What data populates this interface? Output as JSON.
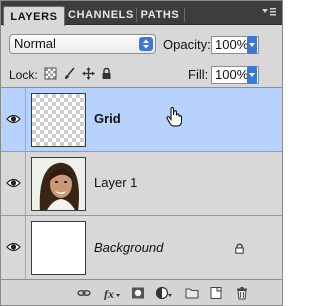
{
  "tabs": [
    {
      "label": "LAYERS",
      "active": true
    },
    {
      "label": "CHANNELS",
      "active": false
    },
    {
      "label": "PATHS",
      "active": false
    }
  ],
  "panel_menu_icon": "panel-menu-icon",
  "blend": {
    "value": "Normal"
  },
  "opacity": {
    "label": "Opacity:",
    "value": "100%"
  },
  "lock": {
    "label": "Lock:"
  },
  "fill": {
    "label": "Fill:",
    "value": "100%"
  },
  "layers": [
    {
      "name": "Grid",
      "selected": true,
      "visible": true,
      "thumbnail": "transparent-checkerboard"
    },
    {
      "name": "Layer 1",
      "selected": false,
      "visible": true,
      "thumbnail": "photo-woman-smiling"
    },
    {
      "name": "Background",
      "selected": false,
      "visible": true,
      "thumbnail": "white",
      "locked": true
    }
  ],
  "colors": {
    "selected_row": "#b7d3fd",
    "tab_bar": "#3d3d3d",
    "accent_blue": "#3d78d6"
  },
  "bottom_icons": [
    "link-layers-icon",
    "fx-icon",
    "add-mask-icon",
    "adjustment-layer-icon",
    "new-group-icon",
    "new-layer-icon",
    "delete-layer-icon"
  ]
}
